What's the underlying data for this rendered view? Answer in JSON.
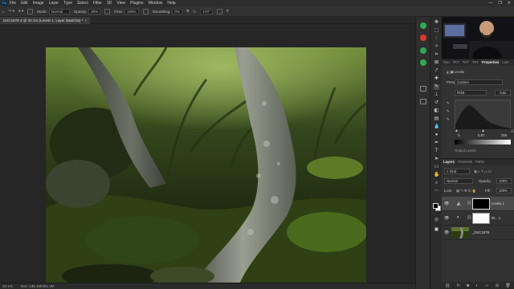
{
  "app": {
    "logo": "Ps"
  },
  "menu": [
    "File",
    "Edit",
    "Image",
    "Layer",
    "Type",
    "Select",
    "Filter",
    "3D",
    "View",
    "Plugins",
    "Window",
    "Help"
  ],
  "window_controls": [
    "—",
    "❐",
    "✕"
  ],
  "options": {
    "mode_label": "Mode:",
    "mode_value": "Normal",
    "opacity_label": "Opacity:",
    "opacity_value": "30%",
    "flow_label": "Flow:",
    "flow_value": "100%",
    "smoothing_label": "Smoothing:",
    "smoothing_value": "0%",
    "angle_value": "170°"
  },
  "document": {
    "tab_title": "DSC1878-3 @ 20.1% (Levels 1, Layer Mask/16) *",
    "close": "×"
  },
  "status": {
    "zoom": "20.1%",
    "doc_info": "Doc: 136.1M/401.3M"
  },
  "properties": {
    "tabs": [
      "Sou",
      "TKT",
      "TKT",
      "TKT",
      "Properties",
      "Lum"
    ],
    "active_tab": "Properties",
    "type_label": "Levels",
    "preset_label": "Preset:",
    "preset_value": "Custom",
    "channel_value": "RGB",
    "auto_label": "Auto",
    "input_low": "0",
    "input_mid": "0.87",
    "input_high": "255",
    "output_label": "Output Levels:"
  },
  "layers": {
    "tabs": [
      "Layers",
      "Channels",
      "Paths"
    ],
    "active_tab": "Layers",
    "kind_label": "Kind",
    "blend_value": "Normal",
    "opacity_label": "Opacity:",
    "opacity_value": "100%",
    "lock_label": "Lock:",
    "fill_label": "Fill:",
    "fill_value": "100%",
    "items": [
      {
        "name": "Levels 1",
        "selected": true
      },
      {
        "name": "Br... 1",
        "selected": false
      },
      {
        "name": "_DSC1878",
        "selected": false
      }
    ],
    "footer_icons": [
      "link-icon",
      "fx-icon",
      "mask-icon",
      "adjustment-icon",
      "group-icon",
      "new-layer-icon",
      "trash-icon"
    ]
  }
}
